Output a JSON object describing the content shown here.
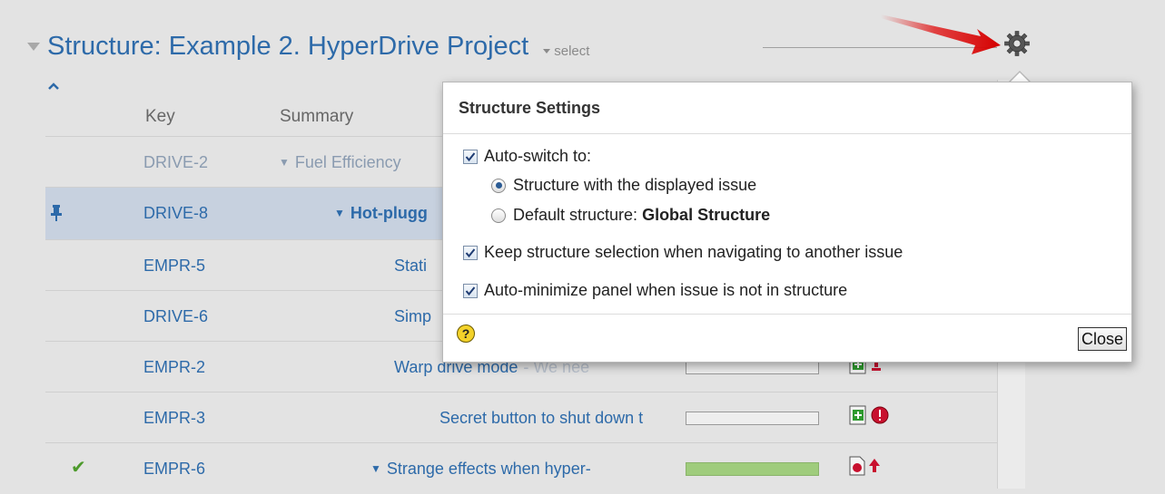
{
  "header": {
    "title": "Structure: Example 2. HyperDrive Project",
    "select_label": "select"
  },
  "grid": {
    "columns": {
      "key": "Key",
      "summary": "Summary"
    },
    "rows": [
      {
        "key": "DRIVE-2",
        "summary": "Fuel Efficiency"
      },
      {
        "key": "DRIVE-8",
        "summary": "Hot-plugg"
      },
      {
        "key": "EMPR-5",
        "summary": "Stati"
      },
      {
        "key": "DRIVE-6",
        "summary": "Simp"
      },
      {
        "key": "EMPR-2",
        "summary": "Warp drive mode",
        "summary_extra": "- We nee"
      },
      {
        "key": "EMPR-3",
        "summary": "Secret button to shut down t"
      },
      {
        "key": "EMPR-6",
        "summary": "Strange effects when hyper-"
      }
    ]
  },
  "popup": {
    "title": "Structure Settings",
    "auto_switch_label": "Auto-switch to:",
    "radio_displayed": "Structure with the displayed issue",
    "radio_default_prefix": "Default structure:",
    "radio_default_value": "Global Structure",
    "keep_selection_label": "Keep structure selection when navigating to another issue",
    "auto_minimize_label": "Auto-minimize panel when issue is not in structure",
    "help_glyph": "?",
    "close_label": "Close",
    "auto_switch_checked": true,
    "keep_selection_checked": true,
    "auto_minimize_checked": true,
    "selected_radio": "displayed"
  },
  "icons": {
    "gear": "gear-icon",
    "arrow": "red-pointer-arrow",
    "help": "help-icon"
  },
  "colors": {
    "link_blue": "#2d6aa9",
    "progress_green": "#9fcc7c",
    "arrow_red": "#e01818"
  }
}
